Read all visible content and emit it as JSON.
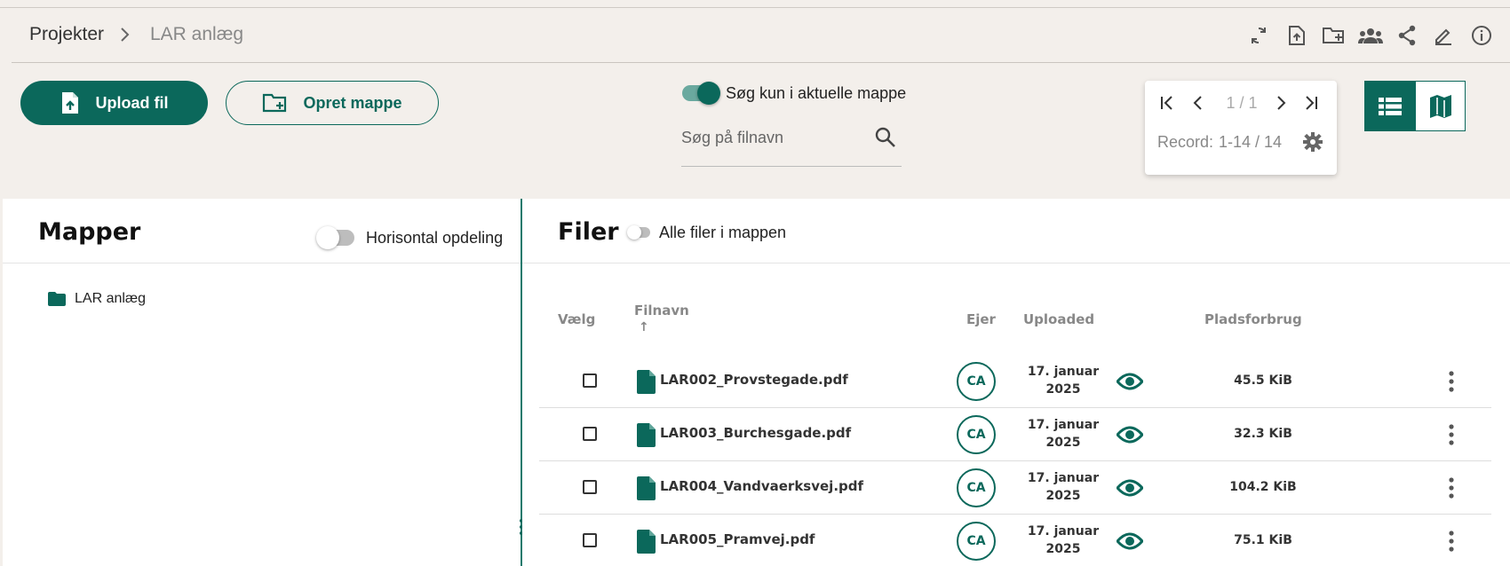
{
  "breadcrumb": {
    "root": "Projekter",
    "current": "LAR anlæg"
  },
  "header_icons": [
    "sync-icon",
    "file-upload-icon",
    "new-folder-icon",
    "group-icon",
    "share-icon",
    "edit-icon",
    "info-icon"
  ],
  "toolbar": {
    "upload_label": "Upload fil",
    "create_folder_label": "Opret mappe",
    "search_toggle_label": "Søg kun i aktuelle mappe",
    "search_toggle_on": true,
    "search_placeholder": "Søg på filnavn"
  },
  "pager": {
    "page": "1 / 1",
    "record_label": "Record:",
    "record_value": "1-14 / 14"
  },
  "colors": {
    "accent": "#0b685b",
    "background": "#f3efeb"
  },
  "folders_panel": {
    "title": "Mapper",
    "toggle_label": "Horisontal opdeling",
    "toggle_on": false,
    "items": [
      {
        "label": "LAR anlæg"
      }
    ]
  },
  "files_panel": {
    "title": "Filer",
    "toggle_label": "Alle filer i mappen",
    "toggle_on": false,
    "columns": {
      "select": "Vælg",
      "name": "Filnavn",
      "sort_indicator": "↑",
      "owner": "Ejer",
      "uploaded": "Uploaded",
      "size": "Pladsforbrug"
    },
    "rows": [
      {
        "name": "LAR002_Provstegade.pdf",
        "owner": "CA",
        "date_line1": "17. januar",
        "date_line2": "2025",
        "size": "45.5 KiB"
      },
      {
        "name": "LAR003_Burchesgade.pdf",
        "owner": "CA",
        "date_line1": "17. januar",
        "date_line2": "2025",
        "size": "32.3 KiB"
      },
      {
        "name": "LAR004_Vandvaerksvej.pdf",
        "owner": "CA",
        "date_line1": "17. januar",
        "date_line2": "2025",
        "size": "104.2 KiB"
      },
      {
        "name": "LAR005_Pramvej.pdf",
        "owner": "CA",
        "date_line1": "17. januar",
        "date_line2": "2025",
        "size": "75.1 KiB"
      }
    ]
  }
}
